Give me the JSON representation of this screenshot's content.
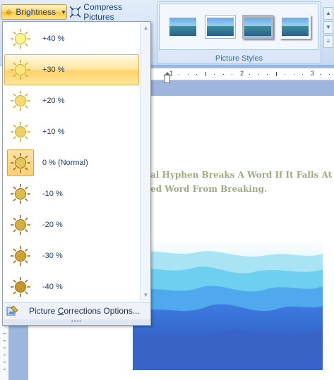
{
  "ribbon": {
    "brightness_label": "Brightness",
    "compress_label": "Compress Pictures",
    "picture_styles_label": "Picture Styles"
  },
  "menu": {
    "items": [
      {
        "label": "+40 %",
        "level": 0.4
      },
      {
        "label": "+30 %",
        "level": 0.3
      },
      {
        "label": "+20 %",
        "level": 0.2
      },
      {
        "label": "+10 %",
        "level": 0.1
      },
      {
        "label": "0 % (Normal)",
        "level": 0.0
      },
      {
        "label": "-10 %",
        "level": -0.1
      },
      {
        "label": "-20 %",
        "level": -0.2
      },
      {
        "label": "-30 %",
        "level": -0.3
      },
      {
        "label": "-40 %",
        "level": -0.4
      }
    ],
    "hovered_label": "+30 %",
    "selected_label": "0 % (Normal)",
    "footer_label_prefix": "Picture ",
    "footer_label_accel": "C",
    "footer_label_suffix": "orrections Options..."
  },
  "ruler": {
    "numbers": [
      "1",
      "2",
      "3"
    ]
  },
  "document": {
    "line1": "al Hyphen Breaks A Word If It Falls At Th",
    "line2": "ed  Word From Breaking."
  },
  "colors": {
    "menu_hover": "#ffd36b",
    "selected_box": "#ffcf7a",
    "doc_text": "#9bab7f",
    "ribbon_text": "#15428b"
  }
}
